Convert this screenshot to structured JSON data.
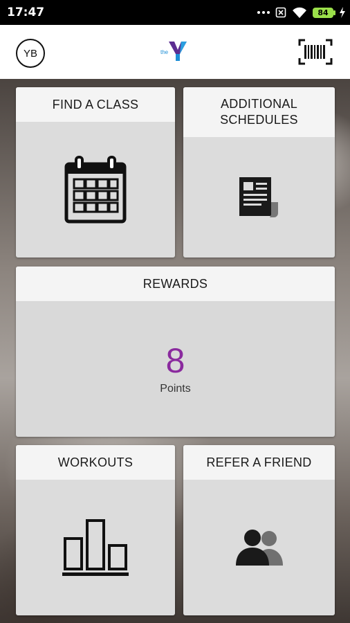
{
  "status_bar": {
    "time": "17:47",
    "battery": "84",
    "icons": [
      "notification-dots-icon",
      "sim-off-icon",
      "wifi-icon",
      "battery-icon",
      "charging-icon"
    ]
  },
  "header": {
    "avatar_initials": "YB",
    "logo_text": "the",
    "logo_icon": "ymca-y-logo",
    "barcode_icon": "barcode-scan-icon"
  },
  "tiles": {
    "find_class": {
      "label": "FIND A CLASS",
      "icon": "calendar-icon"
    },
    "additional_schedules": {
      "label": "ADDITIONAL SCHEDULES",
      "icon": "newspaper-icon"
    },
    "rewards": {
      "label": "REWARDS",
      "points": "8",
      "points_label": "Points"
    },
    "workouts": {
      "label": "WORKOUTS",
      "icon": "bar-chart-icon"
    },
    "refer_friend": {
      "label": "REFER A FRIEND",
      "icon": "people-icon"
    }
  },
  "colors": {
    "points_accent": "#8a2a9e",
    "logo_purple": "#5c2d91",
    "logo_blue": "#1c8ed6",
    "battery_green": "#9be04a"
  }
}
